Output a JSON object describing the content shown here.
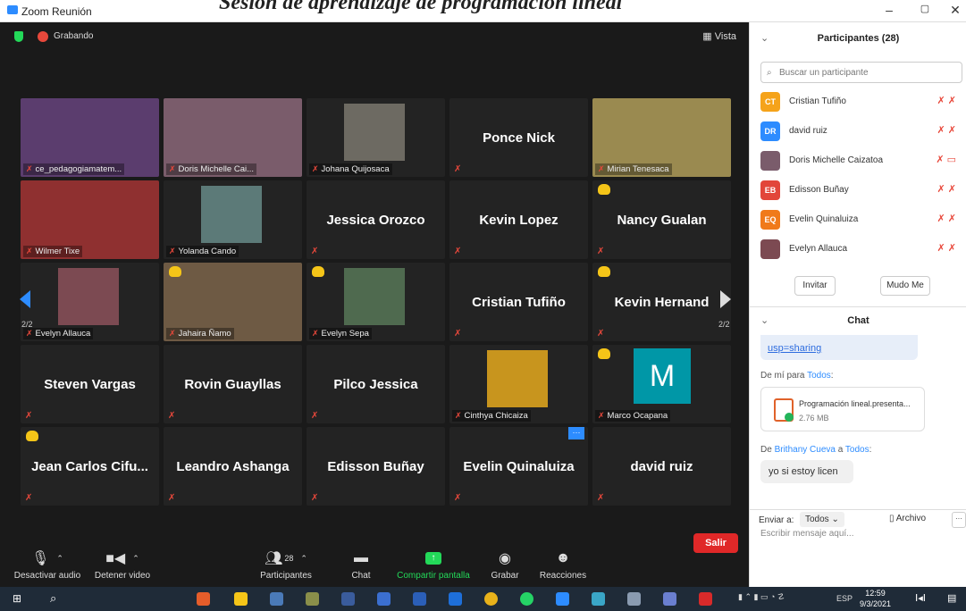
{
  "overlay_caption": "Sesión de aprendizaje de programación lineal",
  "window": {
    "title": "Zoom Reunión",
    "minimize": "–",
    "maximize": "▢",
    "close": "✕"
  },
  "meeting": {
    "recording_label": "Grabando",
    "view_label": "Vista",
    "page_left": "2/2",
    "page_right": "2/2",
    "tiles": [
      {
        "name": "ce_pedagogiamatem...",
        "kind": "photo",
        "photo_color": "#5b3d6e"
      },
      {
        "name": "Doris Michelle Cai...",
        "kind": "photo",
        "photo_color": "#7a5c6b"
      },
      {
        "name": "Johana Quijosaca",
        "kind": "photo",
        "photo_color": "#6d6a62"
      },
      {
        "name": "Ponce Nick",
        "kind": "text"
      },
      {
        "name": "Mirian Tenesaca",
        "kind": "photo",
        "photo_color": "#9a8a50"
      },
      {
        "name": "Wilmer Tixe",
        "kind": "photo",
        "photo_color": "#8f3030"
      },
      {
        "name": "Yolanda Cando",
        "kind": "photo",
        "photo_color": "#5c7a78"
      },
      {
        "name": "Jessica Orozco",
        "kind": "text"
      },
      {
        "name": "Kevin Lopez",
        "kind": "text"
      },
      {
        "name": "Nancy Gualan",
        "kind": "text",
        "hand": true
      },
      {
        "name": "Evelyn Allauca",
        "kind": "photo",
        "photo_color": "#7c4a52"
      },
      {
        "name": "Jahaira Ñamo",
        "kind": "photo",
        "photo_color": "#6e5a44",
        "hand": true
      },
      {
        "name": "Evelyn Sepa",
        "kind": "photo",
        "photo_color": "#4f6a4f",
        "hand": true
      },
      {
        "name": "Cristian Tufiño",
        "kind": "text"
      },
      {
        "name": "Kevin Hernand",
        "kind": "text",
        "hand": true
      },
      {
        "name": "Steven Vargas",
        "kind": "text"
      },
      {
        "name": "Rovin Guayllas",
        "kind": "text"
      },
      {
        "name": "Pilco Jessica",
        "kind": "text"
      },
      {
        "name": "Cinthya Chicaiza",
        "kind": "photo",
        "photo_color": "#c8951e"
      },
      {
        "name": "Marco Ocapana",
        "kind": "letter",
        "letter": "M",
        "photo_color": "#0097a7",
        "hand": true
      },
      {
        "name": "Jean Carlos Cifu...",
        "kind": "text",
        "hand": true
      },
      {
        "name": "Leandro Ashanga",
        "kind": "text"
      },
      {
        "name": "Edisson Buñay",
        "kind": "text"
      },
      {
        "name": "Evelin Quinaluiza",
        "kind": "text",
        "dots": true
      },
      {
        "name": "david ruiz",
        "kind": "text"
      }
    ]
  },
  "toolbar": {
    "mute_label": "Desactivar audio",
    "video_label": "Detener video",
    "participants_label": "Participantes",
    "participants_count": "28",
    "chat_label": "Chat",
    "share_label": "Compartir pantalla",
    "record_label": "Grabar",
    "reactions_label": "Reacciones",
    "leave_label": "Salir"
  },
  "panel": {
    "participants_title": "Participantes (28)",
    "search_placeholder": "Buscar un participante",
    "participants": [
      {
        "initials": "CT",
        "name": "Cristian Tufiño",
        "color": "#f5a31a"
      },
      {
        "initials": "DR",
        "name": "david ruiz",
        "color": "#2d8cff"
      },
      {
        "initials": "",
        "name": "Doris Michelle Caizatoa",
        "color": "#7a5c6b"
      },
      {
        "initials": "EB",
        "name": "Edisson Buñay",
        "color": "#e2463a"
      },
      {
        "initials": "EQ",
        "name": "Evelin Quinaluiza",
        "color": "#f07a1a"
      },
      {
        "initials": "",
        "name": "Evelyn Allauca",
        "color": "#7c4a52"
      }
    ],
    "invite_label": "Invitar",
    "mute_me_label": "Mudo Me",
    "chat_title": "Chat",
    "chat_link_tail": "usp=sharing",
    "msg1_from": "De mí para",
    "msg1_to": "Todos",
    "msg1_colon": ":",
    "file_name": "Programación lineal.presenta...",
    "file_size": "2.76 MB",
    "msg2_from": "De",
    "msg2_sender": "Brithany Cueva",
    "msg2_a": "a",
    "msg2_to": "Todos",
    "msg2_text": "yo si estoy licen",
    "send_to_label": "Enviar a:",
    "send_to_value": "Todos",
    "file_label": "Archivo",
    "more_label": "···",
    "input_placeholder": "Escribir mensaje aquí..."
  },
  "taskbar": {
    "language": "ESP",
    "time": "12:59",
    "date": "9/3/2021"
  }
}
